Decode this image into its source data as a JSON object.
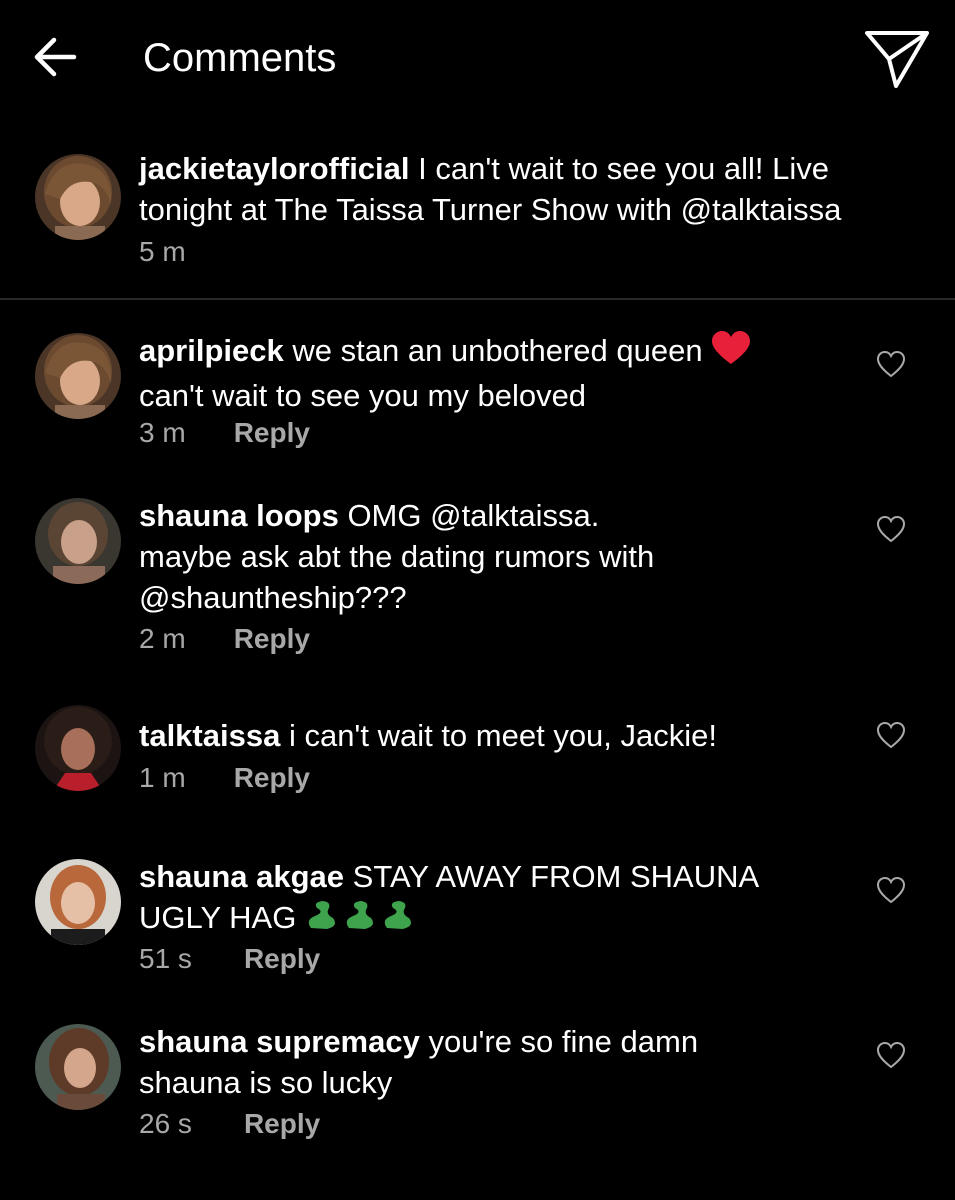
{
  "header": {
    "title": "Comments",
    "back_icon": "arrow-left-icon",
    "send_icon": "paper-plane-icon"
  },
  "caption": {
    "username": "jackietaylorofficial",
    "text": "I can't wait to see you all! Live tonight at The Taissa Turner Show with @talktaissa",
    "time": "5 m"
  },
  "comments": [
    {
      "username": "aprilpieck",
      "text": "we stan an unbothered queen",
      "emoji": "❤️",
      "text2": "can't wait to see you my beloved",
      "time": "3 m",
      "reply_label": "Reply"
    },
    {
      "username": "shauna loops",
      "text": "OMG @talktaissa.",
      "text2": "maybe ask abt the dating rumors with",
      "text3": "@shauntheship???",
      "time": "2 m",
      "reply_label": "Reply"
    },
    {
      "username": "talktaissa",
      "text": "i can't wait to meet you, Jackie!",
      "time": "1 m",
      "reply_label": "Reply"
    },
    {
      "username": "shauna akgae",
      "text": "STAY AWAY FROM SHAUNA",
      "text2": "UGLY HAG",
      "emoji": "🐍🐍🐍",
      "time": "51 s",
      "reply_label": "Reply"
    },
    {
      "username": "shauna supremacy",
      "text": "you're so fine damn",
      "text2": "shauna is so lucky",
      "time": "26 s",
      "reply_label": "Reply"
    }
  ],
  "colors": {
    "background": "#000000",
    "text": "#ffffff",
    "secondary_text": "#a8a8a8",
    "divider": "#2a2a2a",
    "heart_emoji": "#e8203a",
    "snake_emoji": "#3fa34d"
  }
}
